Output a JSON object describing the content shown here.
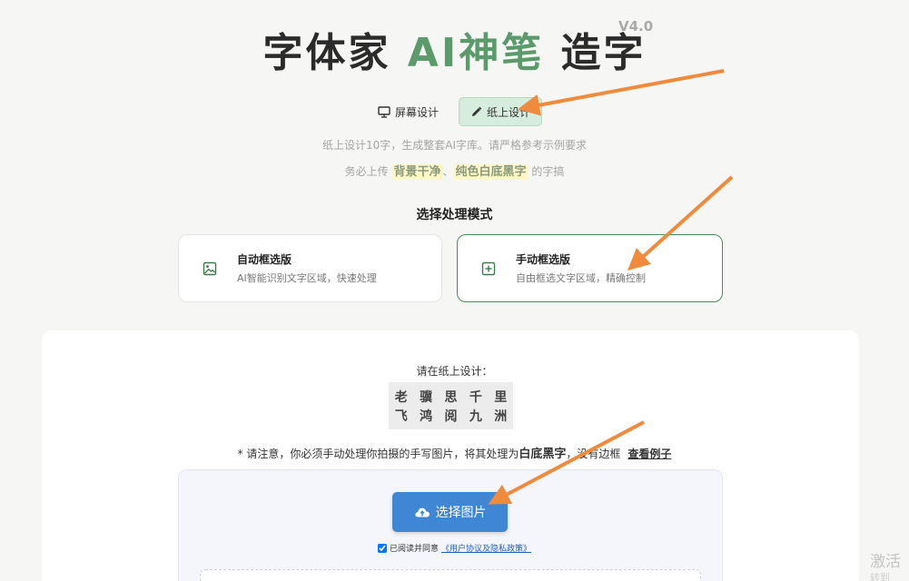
{
  "header": {
    "title_part1": "字体家 ",
    "title_ai": "AI神笔",
    "title_part2": " 造字",
    "version": "V4.0"
  },
  "tabs": [
    {
      "label": "屏幕设计",
      "icon": "monitor-icon",
      "active": false
    },
    {
      "label": "纸上设计",
      "icon": "pencil-icon",
      "active": true
    }
  ],
  "hints": {
    "line1": "纸上设计10字，生成整套AI字库。请严格参考示例要求",
    "line2_prefix": "务必上传 ",
    "line2_hl1": "背景干净",
    "line2_sep": "、",
    "line2_hl2": "纯色白底黑字",
    "line2_suffix": " 的字搞"
  },
  "mode_section": {
    "label": "选择处理模式",
    "auto": {
      "title": "自动框选版",
      "desc": "AI智能识别文字区域，快速处理",
      "icon": "image-icon"
    },
    "manual": {
      "title": "手动框选版",
      "desc": "自由框选文字区域，精确控制",
      "icon": "plus-square-icon",
      "selected": true
    }
  },
  "design": {
    "prompt": "请在纸上设计：",
    "row1": [
      "老",
      "骥",
      "思",
      "千",
      "里"
    ],
    "row2": [
      "飞",
      "鸿",
      "阅",
      "九",
      "洲"
    ],
    "notice_prefix": "* 请注意，你必须手动处理你拍摄的手写图片，将其处理为",
    "notice_bold": "白底黑字",
    "notice_suffix": "，没有边框",
    "example_link": "查看例子"
  },
  "upload": {
    "button_label": "选择图片",
    "button_icon": "cloud-upload-icon",
    "agree_prefix": "已阅读并同意",
    "agree_link": "《用户协议及隐私政策》",
    "agree_checked": true
  },
  "watermark": {
    "line1": "激活",
    "line2": "转到"
  },
  "colors": {
    "brand_green": "#5b9a6b",
    "button_blue": "#3f86d4",
    "arrow": "#f08a3c"
  }
}
